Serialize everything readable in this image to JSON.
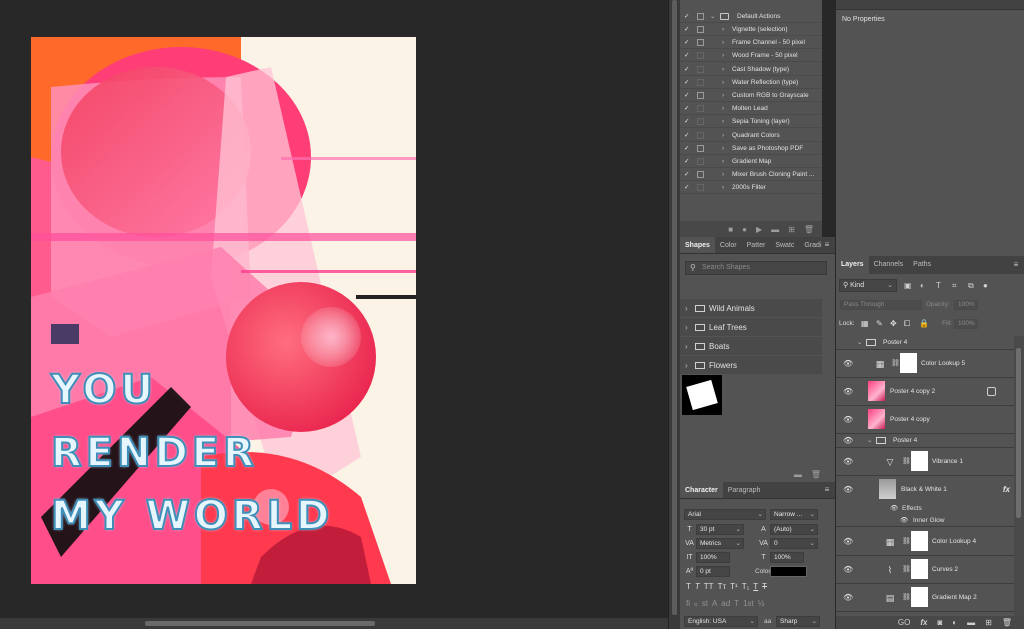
{
  "poster": {
    "lines": [
      "YOU",
      "RENDER",
      "MY WORLD"
    ]
  },
  "actions": {
    "set_name": "Default Actions",
    "items": [
      {
        "label": "Vignette (selection)",
        "box": true
      },
      {
        "label": "Frame Channel - 50 pixel",
        "box": true
      },
      {
        "label": "Wood Frame - 50 pixel",
        "box": false
      },
      {
        "label": "Cast Shadow (type)",
        "box": false
      },
      {
        "label": "Water Reflection (type)",
        "box": false
      },
      {
        "label": "Custom RGB to Grayscale",
        "box": true
      },
      {
        "label": "Molten Lead",
        "box": false
      },
      {
        "label": "Sepia Toning (layer)",
        "box": false
      },
      {
        "label": "Quadrant Colors",
        "box": false
      },
      {
        "label": "Save as Photoshop PDF",
        "box": true
      },
      {
        "label": "Gradient Map",
        "box": false
      },
      {
        "label": "Mixer Brush Cloning Paint ...",
        "box": true
      },
      {
        "label": "2000s Filter",
        "box": false
      }
    ],
    "check_glyph": "✓",
    "toolbar_icons": [
      "stop-icon",
      "record-icon",
      "play-icon",
      "folder-icon",
      "new-action-icon",
      "trash-icon"
    ]
  },
  "properties": {
    "empty_text": "No Properties"
  },
  "shapes": {
    "tabs": [
      "Shapes",
      "Color",
      "Patter",
      "Swatc",
      "Gradi"
    ],
    "search_placeholder": "Search Shapes",
    "groups": [
      "Wild Animals",
      "Leaf Trees",
      "Boats",
      "Flowers"
    ]
  },
  "character": {
    "tabs": [
      "Character",
      "Paragraph"
    ],
    "font_family": "Arial",
    "font_style": "Narrow ...",
    "font_size": "30 pt",
    "leading": "(Auto)",
    "kerning": "Metrics",
    "tracking": "0",
    "vertical_scale": "100%",
    "horizontal_scale": "100%",
    "baseline_shift": "0 pt",
    "color_label": "Color:",
    "color": "#000000",
    "language": "English: USA",
    "aa_label": "aa",
    "antialias": "Sharp",
    "type_styles": [
      "T",
      "T",
      "TT",
      "Tт",
      "T¹",
      "T₁",
      "T",
      "T"
    ],
    "opentype": [
      "fi",
      "ℴ",
      "st",
      "A",
      "ad",
      "T",
      "1st",
      "½"
    ]
  },
  "layers": {
    "tabs": [
      "Layers",
      "Channels",
      "Paths"
    ],
    "kind": "Kind",
    "blend_mode": "Pass Through",
    "opacity_label": "Opacity:",
    "opacity": "100%",
    "lock_label": "Lock:",
    "fill_label": "Fill:",
    "fill": "100%",
    "group_top": "Poster 4",
    "color_lookup_5": "Color Lookup 5",
    "copy2": "Poster 4 copy 2",
    "copy": "Poster 4 copy",
    "group_inner": "Poster 4",
    "vibrance": "Vibrance 1",
    "bw": "Black & White 1",
    "fx": "fx",
    "effects": "Effects",
    "inner_glow": "Inner Glow",
    "color_lookup_4": "Color Lookup 4",
    "curves": "Curves 2",
    "gradient_map": "Gradient Map 2",
    "footer_link": "GO",
    "footer_fx": "fx"
  }
}
